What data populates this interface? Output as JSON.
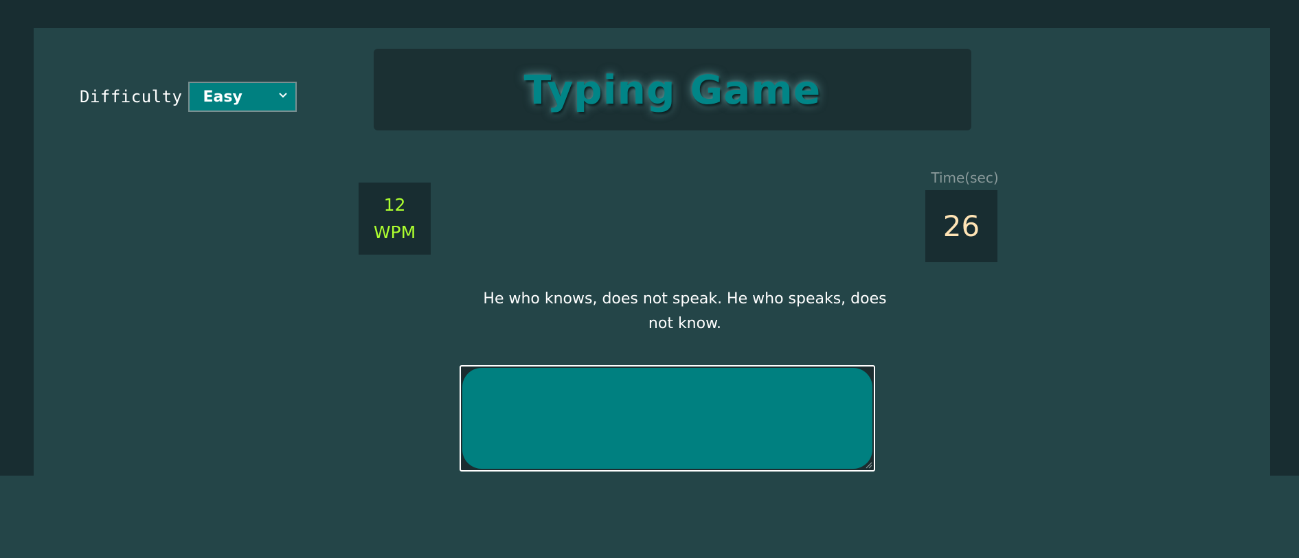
{
  "settings": {
    "difficulty_label": "Difficulty",
    "difficulty_value": "Easy"
  },
  "header": {
    "title": "Typing Game"
  },
  "stats": {
    "wpm_value": "12",
    "wpm_label": "WPM",
    "time_label": "Time(sec)",
    "time_value": "26"
  },
  "game": {
    "quote": "He who knows, does not speak. He who speaks, does not know.",
    "input_value": ""
  },
  "icons": {
    "dropdown": "chevron-down-icon",
    "resize": "resize-handle-icon"
  },
  "colors": {
    "accent": "#008080",
    "wpm": "#adff2f",
    "time": "#ffe4b5",
    "panel": "#244548",
    "frame": "#182d31"
  }
}
